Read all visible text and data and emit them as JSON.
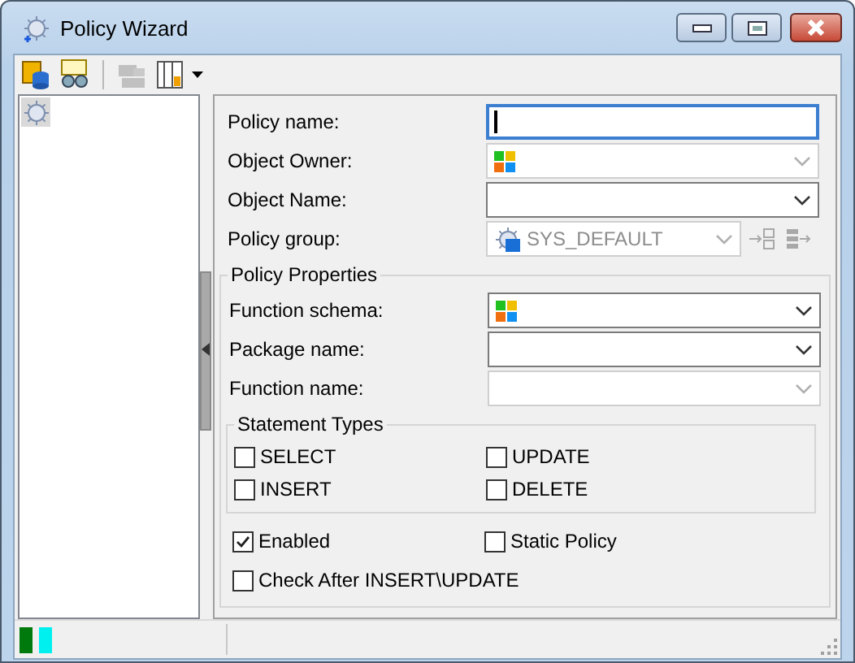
{
  "window": {
    "title": "Policy Wizard"
  },
  "toolbar": [
    {
      "kind": "button",
      "disabled": false
    },
    {
      "kind": "button",
      "disabled": false
    },
    {
      "kind": "button",
      "disabled": true
    },
    {
      "kind": "dropdown",
      "disabled": false
    }
  ],
  "tree": [
    {
      "selected": true
    }
  ],
  "fields": [
    {
      "label": "Policy name:",
      "kind": "text",
      "focused": true,
      "disabled": false
    },
    {
      "label": "Object Owner:",
      "kind": "schema-combo",
      "disabled": true
    },
    {
      "label": "Object Name:",
      "kind": "combo",
      "disabled": false
    },
    {
      "label": "Policy group:",
      "kind": "policy-combo",
      "disabled": true,
      "value": "SYS_DEFAULT",
      "side_buttons": [
        {
          "disabled": true
        },
        {
          "disabled": true
        }
      ]
    }
  ],
  "policy_properties": {
    "title": "Policy Properties",
    "fields": [
      {
        "label": "Function schema:",
        "kind": "schema-combo",
        "disabled": false
      },
      {
        "label": "Package name:",
        "kind": "combo",
        "disabled": false
      },
      {
        "label": "Function name:",
        "kind": "combo",
        "disabled": true
      }
    ],
    "statement_types": {
      "title": "Statement Types",
      "options": [
        {
          "label": "SELECT",
          "checked": false
        },
        {
          "label": "UPDATE",
          "checked": false
        },
        {
          "label": "INSERT",
          "checked": false
        },
        {
          "label": "DELETE",
          "checked": false
        }
      ]
    },
    "options": [
      {
        "label": "Enabled",
        "checked": true
      },
      {
        "label": "Static Policy",
        "checked": false
      },
      {
        "label": "Check After INSERT\\UPDATE",
        "checked": false
      }
    ]
  },
  "status_bar": {
    "indicators": [
      {
        "color": "#007a0c"
      },
      {
        "color": "#00f0f0"
      }
    ]
  }
}
